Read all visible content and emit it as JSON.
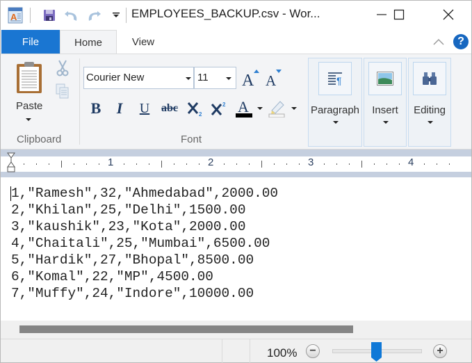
{
  "window": {
    "title": "EMPLOYEES_BACKUP.csv - Wor...",
    "controls": {
      "minimize": "minimize",
      "maximize": "maximize",
      "close": "close"
    }
  },
  "quick_access": {
    "items": [
      "app-icon",
      "save-icon",
      "undo-icon",
      "redo-icon",
      "customize-quick-access-icon"
    ]
  },
  "ribbon": {
    "tabs": [
      {
        "label": "File",
        "active": false
      },
      {
        "label": "Home",
        "active": true
      },
      {
        "label": "View",
        "active": false
      }
    ],
    "groups": {
      "clipboard": {
        "label": "Clipboard",
        "paste_label": "Paste"
      },
      "font": {
        "label": "Font",
        "font_name": "Courier New",
        "font_size": "11",
        "font_color": "#000000"
      },
      "paragraph": {
        "label": "Paragraph"
      },
      "insert": {
        "label": "Insert"
      },
      "editing": {
        "label": "Editing"
      }
    }
  },
  "ruler": {
    "numbers": [
      "1",
      "2",
      "3",
      "4"
    ]
  },
  "document": {
    "lines": [
      "1,\"Ramesh\",32,\"Ahmedabad\",2000.00",
      "2,\"Khilan\",25,\"Delhi\",1500.00",
      "3,\"kaushik\",23,\"Kota\",2000.00",
      "4,\"Chaitali\",25,\"Mumbai\",6500.00",
      "5,\"Hardik\",27,\"Bhopal\",8500.00",
      "6,\"Komal\",22,\"MP\",4500.00",
      "7,\"Muffy\",24,\"Indore\",10000.00"
    ]
  },
  "status": {
    "zoom_label": "100%",
    "zoom_value_percent": 100,
    "zoom_out": "−",
    "zoom_in": "+"
  },
  "colors": {
    "accent": "#1a76d2",
    "help": "#1767c0",
    "slider": "#0f78d7"
  }
}
